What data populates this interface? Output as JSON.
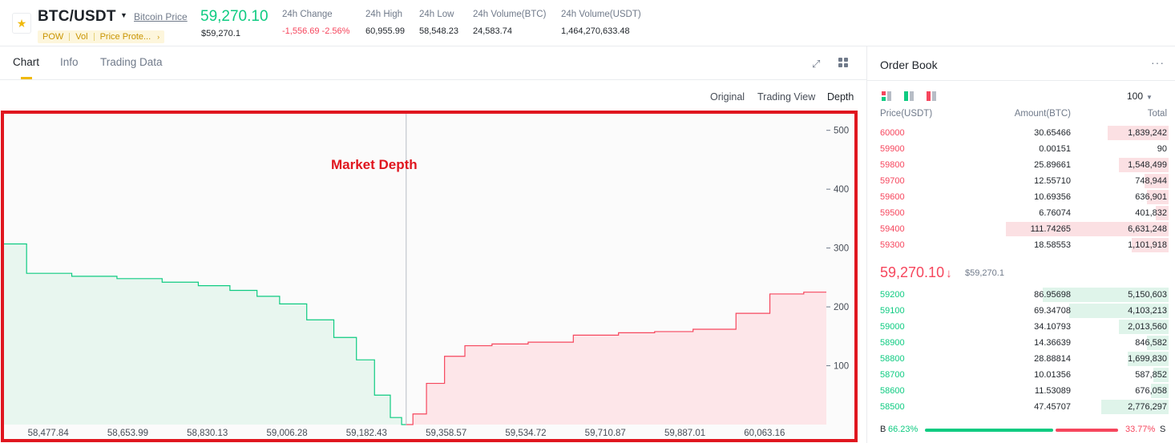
{
  "ticker": {
    "pair": "BTC/USDT",
    "link_label": "Bitcoin Price",
    "tags": [
      "POW",
      "Vol",
      "Price Prote..."
    ],
    "last_price": "59,270.10",
    "last_price_usd": "$59,270.1",
    "stats": [
      {
        "label": "24h Change",
        "value": "-1,556.69 -2.56%",
        "negative": true
      },
      {
        "label": "24h High",
        "value": "60,955.99"
      },
      {
        "label": "24h Low",
        "value": "58,548.23"
      },
      {
        "label": "24h Volume(BTC)",
        "value": "24,583.74"
      },
      {
        "label": "24h Volume(USDT)",
        "value": "1,464,270,633.48"
      }
    ]
  },
  "chart_tabs": [
    "Chart",
    "Info",
    "Trading Data"
  ],
  "views": [
    "Original",
    "Trading View",
    "Depth"
  ],
  "colors": {
    "bid": "#0ecb81",
    "ask": "#f6465d",
    "accent": "#f0b90b",
    "highlight_frame": "#e0161f"
  },
  "chart_data": {
    "type": "area",
    "title": "Market Depth",
    "x_ticks": [
      "58,477.84",
      "58,653.99",
      "58,830.13",
      "59,006.28",
      "59,182.43",
      "59,358.57",
      "59,534.72",
      "59,710.87",
      "59,887.01",
      "60,063.16"
    ],
    "y_ticks": [
      "500",
      "400",
      "300",
      "200",
      "100"
    ],
    "ylim": [
      0,
      520
    ],
    "mid_price": 59270.1,
    "series": [
      {
        "side": "bid",
        "color": "#0ecb81",
        "x": [
          58380,
          58480,
          58580,
          58680,
          58780,
          58840,
          58920,
          58960,
          59020,
          59080,
          59140,
          59180,
          59220,
          59250,
          59270
        ],
        "y": [
          307,
          257,
          252,
          248,
          242,
          236,
          228,
          218,
          205,
          178,
          148,
          110,
          50,
          12,
          0
        ]
      },
      {
        "side": "ask",
        "color": "#f6465d",
        "x": [
          59270,
          59300,
          59330,
          59380,
          59420,
          59500,
          59580,
          59700,
          59780,
          59860,
          59950,
          60050,
          60100,
          60200
        ],
        "y": [
          0,
          18,
          70,
          116,
          134,
          137,
          140,
          152,
          156,
          158,
          162,
          189,
          222,
          225
        ]
      }
    ]
  },
  "orderbook": {
    "title": "Order Book",
    "more": "···",
    "group": "100",
    "cols": [
      "Price(USDT)",
      "Amount(BTC)",
      "Total"
    ],
    "asks": [
      {
        "price": "60000",
        "amount": "30.65466",
        "total": "1,839,242",
        "depth": 0.28
      },
      {
        "price": "59900",
        "amount": "0.00151",
        "total": "90",
        "depth": 0.0
      },
      {
        "price": "59800",
        "amount": "25.89661",
        "total": "1,548,499",
        "depth": 0.23
      },
      {
        "price": "59700",
        "amount": "12.55710",
        "total": "748,944",
        "depth": 0.11
      },
      {
        "price": "59600",
        "amount": "10.69356",
        "total": "636,901",
        "depth": 0.1
      },
      {
        "price": "59500",
        "amount": "6.76074",
        "total": "401,832",
        "depth": 0.06
      },
      {
        "price": "59400",
        "amount": "111.74265",
        "total": "6,631,248",
        "depth": 0.75
      },
      {
        "price": "59300",
        "amount": "18.58553",
        "total": "1,101,918",
        "depth": 0.17
      }
    ],
    "mid_price": "59,270.10",
    "mid_arrow": "↓",
    "mid_usd": "$59,270.1",
    "bids": [
      {
        "price": "59200",
        "amount": "86.95698",
        "total": "5,150,603",
        "depth": 0.58
      },
      {
        "price": "59100",
        "amount": "69.34708",
        "total": "4,103,213",
        "depth": 0.46
      },
      {
        "price": "59000",
        "amount": "34.10793",
        "total": "2,013,560",
        "depth": 0.23
      },
      {
        "price": "58900",
        "amount": "14.36639",
        "total": "846,582",
        "depth": 0.1
      },
      {
        "price": "58800",
        "amount": "28.88814",
        "total": "1,699,830",
        "depth": 0.19
      },
      {
        "price": "58700",
        "amount": "10.01356",
        "total": "587,852",
        "depth": 0.07
      },
      {
        "price": "58600",
        "amount": "11.53089",
        "total": "676,058",
        "depth": 0.08
      },
      {
        "price": "58500",
        "amount": "47.45707",
        "total": "2,776,297",
        "depth": 0.31
      }
    ],
    "ratio": {
      "b_label": "B",
      "b": "66.23%",
      "s": "33.77%",
      "s_label": "S",
      "b_fraction": 0.6623
    }
  }
}
